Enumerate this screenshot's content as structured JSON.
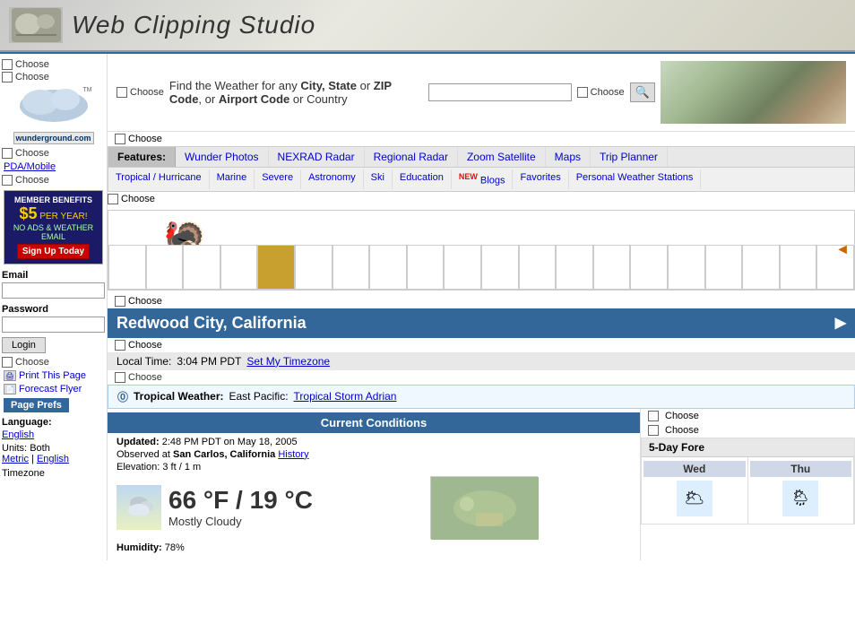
{
  "header": {
    "title": "Web Clipping Studio",
    "logo_symbol": "⚙"
  },
  "sidebar": {
    "choose_labels": [
      "Choose",
      "Choose",
      "Choose"
    ],
    "pda_link": "PDA/Mobile",
    "choose_below_pda": "Choose",
    "member_benefits": {
      "title": "MEMBER BENEFITS",
      "price": "$5",
      "per_year": "PER YEAR!",
      "benefit1": "NO ADS & WEATHER EMAIL",
      "signup": "Sign Up Today"
    },
    "email_label": "Email",
    "password_label": "Password",
    "login_label": "Login",
    "choose_bottom": "Choose",
    "print_label": "Print This Page",
    "forecast_flyer_label": "Forecast Flyer",
    "page_prefs_label": "Page Prefs",
    "language_label": "Language:",
    "language_value": "English",
    "units_label": "Units:",
    "units_value": "Both",
    "metric_label": "Metric",
    "english_label": "English",
    "timezone_label": "Timezone"
  },
  "search": {
    "prompt": "Find the Weather for any",
    "city": "City, State",
    "or1": "or",
    "zip": "ZIP Code",
    "or2": ", or",
    "airport": "Airport Code",
    "or3": "or",
    "country": "Country",
    "placeholder": "",
    "choose_label": "Choose",
    "search_icon": "🔍"
  },
  "nav": {
    "choose_label": "Choose",
    "features_label": "Features:",
    "top_items": [
      "Wunder Photos",
      "NEXRAD Radar",
      "Regional Radar",
      "Zoom Satellite",
      "Maps",
      "Trip Planner"
    ],
    "bottom_items": [
      "Tropical / Hurricane",
      "Marine",
      "Severe",
      "Astronomy",
      "Ski",
      "Education",
      "Blogs",
      "Favorites",
      "Personal Weather Stations"
    ],
    "blogs_new_label": "NEW"
  },
  "puzzle": {
    "choose_label": "Choose",
    "arrow": "◄"
  },
  "city": {
    "name": "Redwood City, California",
    "choose_label1": "Choose",
    "choose_label2": "Choose"
  },
  "local_time": {
    "label": "Local Time:",
    "time": "3:04 PM PDT",
    "timezone_link": "Set My Timezone",
    "choose_label": "Choose"
  },
  "tropical": {
    "icon": "⓪",
    "label": "Tropical Weather:",
    "region": "East Pacific:",
    "storm_link": "Tropical Storm Adrian"
  },
  "conditions": {
    "header": "Current Conditions",
    "updated_label": "Updated:",
    "updated_value": "2:48 PM PDT on May 18, 2005",
    "observed_label": "Observed at",
    "observed_value": "San Carlos, California",
    "history_label": "History",
    "elevation_label": "Elevation:",
    "elevation_value": "3 ft / 1 m",
    "temp_f": "66 °F",
    "temp_c": "19 °C",
    "separator": "/",
    "description": "Mostly Cloudy",
    "humidity_label": "Humidity:",
    "humidity_value": "78%",
    "choose_label1": "Choose",
    "choose_label2": "Choose"
  },
  "forecast": {
    "header": "5-Day Fore",
    "days": [
      {
        "name": "Wed",
        "icon": "🌥"
      },
      {
        "name": "Thu",
        "icon": "🌦"
      }
    ]
  }
}
